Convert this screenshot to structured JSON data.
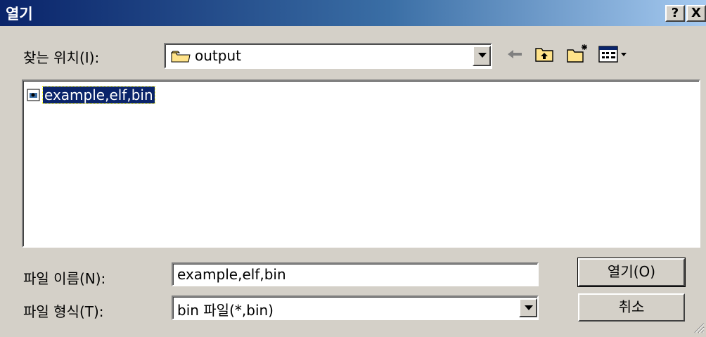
{
  "window": {
    "title": "열기",
    "help_label": "?",
    "close_label": "X"
  },
  "location": {
    "label": "찾는 위치(I):",
    "current_folder": "output"
  },
  "files": [
    {
      "name": "example,elf,bin"
    }
  ],
  "filename": {
    "label": "파일 이름(N):",
    "value": "example,elf,bin"
  },
  "filetype": {
    "label": "파일 형식(T):",
    "value": "bin 파일(*,bin)"
  },
  "buttons": {
    "open_label": "열기(O)",
    "cancel_label": "취소"
  },
  "icons": {
    "back": "back-arrow-icon",
    "up": "up-folder-icon",
    "new": "new-folder-icon",
    "view": "view-menu-icon"
  }
}
